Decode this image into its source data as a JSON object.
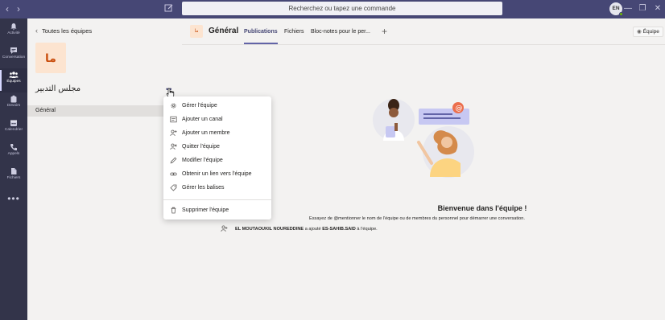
{
  "titlebar": {
    "search_placeholder": "Recherchez ou tapez une commande",
    "avatar_initials": "EN"
  },
  "appbar": {
    "items": [
      {
        "label": "Activité",
        "icon": "bell-icon"
      },
      {
        "label": "Conversation",
        "icon": "chat-icon"
      },
      {
        "label": "Équipes",
        "icon": "teams-icon"
      },
      {
        "label": "Devoirs",
        "icon": "assignments-icon"
      },
      {
        "label": "Calendrier",
        "icon": "calendar-icon"
      },
      {
        "label": "Appels",
        "icon": "phone-icon"
      },
      {
        "label": "Fichiers",
        "icon": "files-icon"
      }
    ],
    "more": "•••"
  },
  "team_panel": {
    "back_label": "Toutes les équipes",
    "logo_text": "ما",
    "team_name": "مجلس التدبير",
    "more": "•••",
    "channels": [
      {
        "label": "Général"
      }
    ]
  },
  "channel_header": {
    "avatar_text": "ما",
    "title": "Général",
    "tabs": [
      {
        "label": "Publications"
      },
      {
        "label": "Fichiers"
      },
      {
        "label": "Bloc-notes pour le per..."
      }
    ],
    "add_tab": "+",
    "team_button": "Équipe"
  },
  "context_menu": {
    "items": [
      {
        "label": "Gérer l'équipe",
        "icon": "gear-icon"
      },
      {
        "label": "Ajouter un canal",
        "icon": "add-channel-icon"
      },
      {
        "label": "Ajouter un membre",
        "icon": "add-member-icon"
      },
      {
        "label": "Quitter l'équipe",
        "icon": "leave-icon"
      },
      {
        "label": "Modifier l'équipe",
        "icon": "pencil-icon"
      },
      {
        "label": "Obtenir un lien vers l'équipe",
        "icon": "link-icon"
      },
      {
        "label": "Gérer les balises",
        "icon": "tag-icon"
      }
    ],
    "delete_label": "Supprimer l'équipe"
  },
  "welcome": {
    "title": "Bienvenue dans l'équipe !",
    "subtitle": "Essayez de @mentionner le nom de l'équipe ou de membres du personnel pour démarrer une conversation.",
    "activity_actor": "EL MOUTAOUKIL NOUREDDINE",
    "activity_verb": "a ajouté",
    "activity_target": "ES-SAHIB.SAID",
    "activity_suffix": "à l'équipe."
  }
}
